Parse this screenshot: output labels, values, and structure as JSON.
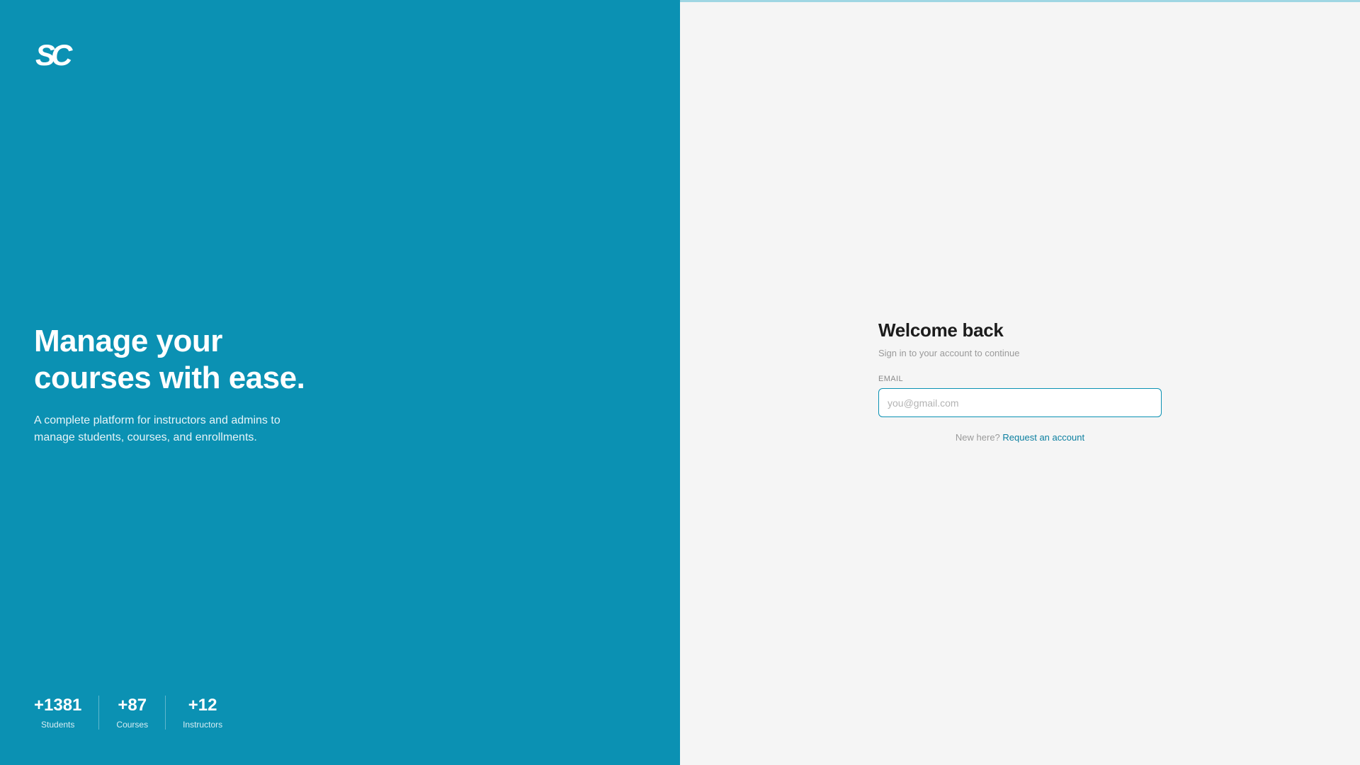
{
  "hero": {
    "logo": "SC",
    "title_line1": "Manage your",
    "title_line2": "courses with ease.",
    "subtitle": "A complete platform for instructors and admins to manage students, courses, and enrollments.",
    "stats": [
      {
        "value": "+1381",
        "label": "Students"
      },
      {
        "value": "+87",
        "label": "Courses"
      },
      {
        "value": "+12",
        "label": "Instructors"
      }
    ]
  },
  "auth": {
    "title": "Welcome back",
    "subtitle": "Sign in to your account to continue",
    "email_label": "EMAIL",
    "email_placeholder": "you@gmail.com",
    "email_value": "",
    "signup_prompt": "New here?",
    "signup_link": "Request an account"
  },
  "colors": {
    "brand": "#0b91b3",
    "link": "#0b7fa0",
    "background": "#f5f5f5",
    "heading": "#1c1c1c",
    "muted": "#9a9a9a"
  },
  "icons": {
    "logo": "sc-logo-icon"
  }
}
